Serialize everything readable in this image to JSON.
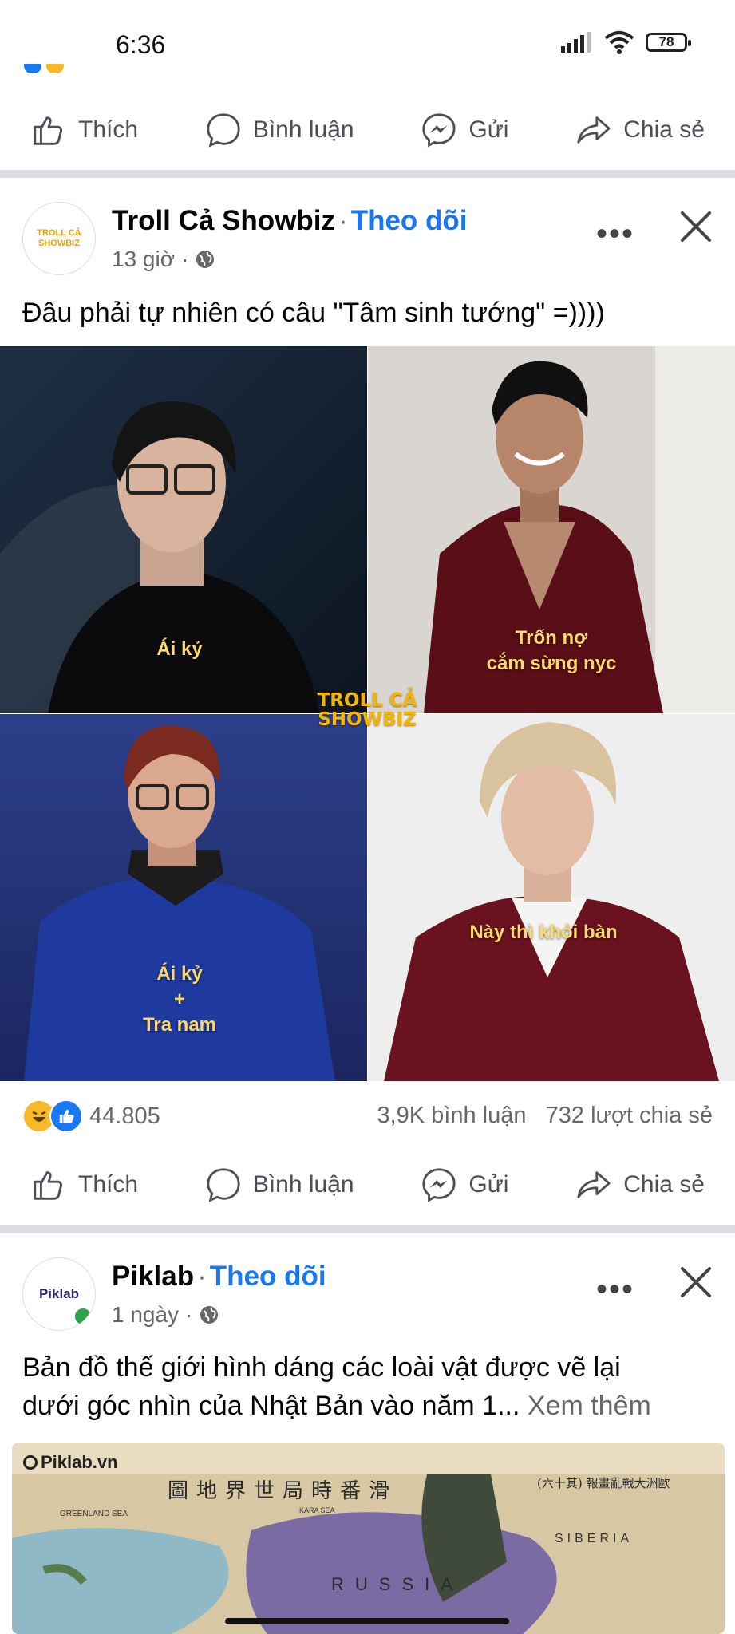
{
  "status_bar": {
    "time": "6:36",
    "battery": "78"
  },
  "action_labels": {
    "like": "Thích",
    "comment": "Bình luận",
    "send": "Gửi",
    "share": "Chia sẻ"
  },
  "post1": {
    "page_name": "Troll Cả Showbiz",
    "follow": "Theo dõi",
    "time": "13 giờ",
    "caption": "Đâu phải tự nhiên có câu \"Tâm sinh tướng\" =))))",
    "avatar_text": "TROLL CẢ SHOWBIZ",
    "watermark_line1": "TROLL CẢ",
    "watermark_line2": "SHOWBIZ",
    "tags": {
      "top_left": "Ái kỷ",
      "top_right_line1": "Trốn nợ",
      "top_right_line2": "cắm sừng nyc",
      "bottom_left_line1": "Ái kỷ",
      "bottom_left_line2": "+",
      "bottom_left_line3": "Tra nam",
      "bottom_right": "Này thì khỏi bàn"
    },
    "reactions_count": "44.805",
    "comments": "3,9K bình luận",
    "shares": "732 lượt chia sẻ"
  },
  "post2": {
    "page_name": "Piklab",
    "follow": "Theo dõi",
    "time": "1 ngày",
    "avatar_text": "Piklab",
    "caption_line1": "Bản đồ thế giới hình dáng các loài vật được vẽ lại",
    "caption_line2": "dưới góc nhìn của Nhật Bản vào năm 1...",
    "see_more": "Xem thêm",
    "image_brand": "Piklab.vn",
    "map_title": "圖地界世局時番滑",
    "map_subtitle": "(六十其) 報畫亂戰大洲歐",
    "map_labels": {
      "greenland": "GREENLAND SEA",
      "siberia": "SIBERIA",
      "kara": "KARA SEA",
      "russia": "RUSSIA"
    }
  },
  "colors": {
    "accent": "#1877f2",
    "divider": "#dadde1",
    "tag_yellow": "#ffd86a"
  }
}
